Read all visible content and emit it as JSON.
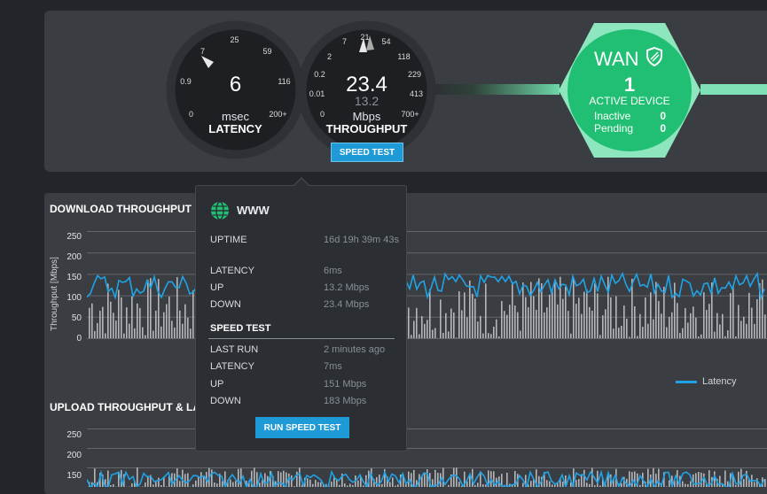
{
  "latency_gauge": {
    "value": "6",
    "unit": "msec",
    "label": "LATENCY",
    "ticks": [
      "0",
      "0.9",
      "7",
      "25",
      "59",
      "116",
      "200+"
    ]
  },
  "throughput_gauge": {
    "value": "23.4",
    "sub_value": "13.2",
    "unit": "Mbps",
    "label": "THROUGHPUT",
    "ticks": [
      "0",
      "0.01",
      "0.2",
      "2",
      "7",
      "21",
      "54",
      "118",
      "229",
      "413",
      "700+"
    ]
  },
  "speed_test_button": "SPEED TEST",
  "wan": {
    "title": "WAN",
    "active_count": "1",
    "active_label": "ACTIVE DEVICE",
    "inactive_label": "Inactive",
    "inactive_count": "0",
    "pending_label": "Pending",
    "pending_count": "0",
    "icon": "shield-icon"
  },
  "download_chart": {
    "title": "DOWNLOAD THROUGHPUT",
    "ylabel": "Throughput [Mbps]",
    "yticks": [
      "250",
      "200",
      "150",
      "100",
      "50",
      "0"
    ]
  },
  "upload_chart": {
    "title": "UPLOAD THROUGHPUT & LA",
    "yticks": [
      "250",
      "200",
      "150"
    ]
  },
  "legend": {
    "latency": "Latency"
  },
  "colors": {
    "accent_blue": "#1e9ad6",
    "latency_line": "#1fa3e6",
    "wan_green": "#20bf73",
    "wan_ring": "#8ee6be",
    "bar_gray": "#b4b6b9"
  },
  "popover": {
    "icon": "globe-icon",
    "title": "WWW",
    "rows": [
      {
        "key": "UPTIME",
        "value": "16d 19h 39m 43s"
      },
      {
        "key": "LATENCY",
        "value": "6ms"
      },
      {
        "key": "UP",
        "value": "13.2 Mbps"
      },
      {
        "key": "DOWN",
        "value": "23.4 Mbps"
      }
    ],
    "speed_test_heading": "SPEED TEST",
    "speed_rows": [
      {
        "key": "LAST RUN",
        "value": "2 minutes ago"
      },
      {
        "key": "LATENCY",
        "value": "7ms"
      },
      {
        "key": "UP",
        "value": "151 Mbps"
      },
      {
        "key": "DOWN",
        "value": "183 Mbps"
      }
    ],
    "run_button": "RUN SPEED TEST"
  },
  "chart_data": [
    {
      "type": "bar",
      "title": "DOWNLOAD THROUGHPUT",
      "ylabel": "Throughput [Mbps]",
      "ylim": [
        0,
        250
      ],
      "grid": true,
      "legend_position": "bottom-right",
      "series": [
        {
          "name": "Latency",
          "kind": "line"
        }
      ],
      "x": [],
      "values": []
    },
    {
      "type": "bar",
      "title": "UPLOAD THROUGHPUT & LA",
      "ylim": [
        0,
        250
      ],
      "grid": true,
      "values": []
    }
  ]
}
